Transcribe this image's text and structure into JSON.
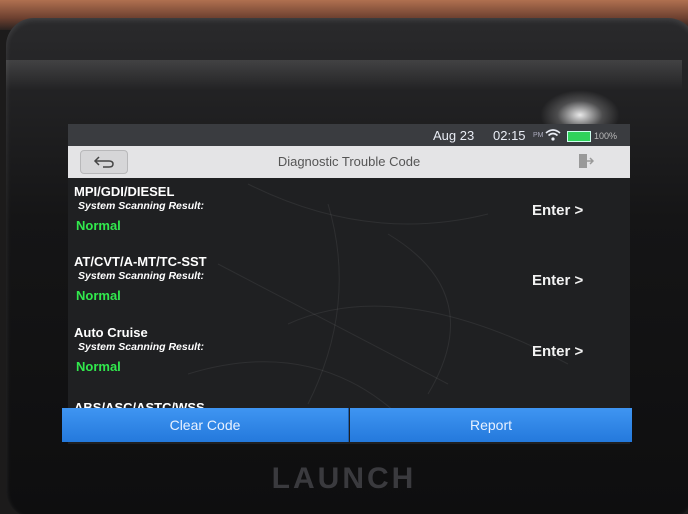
{
  "status_bar": {
    "date": "Aug 23",
    "time": "02:15",
    "ampm": "PM",
    "battery_percent": "100%",
    "battery_color": "#2fd25a"
  },
  "title_bar": {
    "title": "Diagnostic Trouble Code",
    "back_icon": "back-arrow-icon",
    "exit_icon": "exit-icon"
  },
  "systems": [
    {
      "name": "MPI/GDI/DIESEL",
      "result_label": "System Scanning Result:",
      "status": "Normal",
      "action": "Enter >"
    },
    {
      "name": "AT/CVT/A-MT/TC-SST",
      "result_label": "System Scanning Result:",
      "status": "Normal",
      "action": "Enter >"
    },
    {
      "name": "Auto Cruise",
      "result_label": "System Scanning Result:",
      "status": "Normal",
      "action": "Enter >"
    }
  ],
  "partial_item": "ABS/ASC/ASTC/WSS",
  "bottom_bar": {
    "clear_label": "Clear Code",
    "report_label": "Report",
    "button_color": "#2f86ea"
  },
  "device_brand": "LAUNCH",
  "status_color": "#31e94d"
}
